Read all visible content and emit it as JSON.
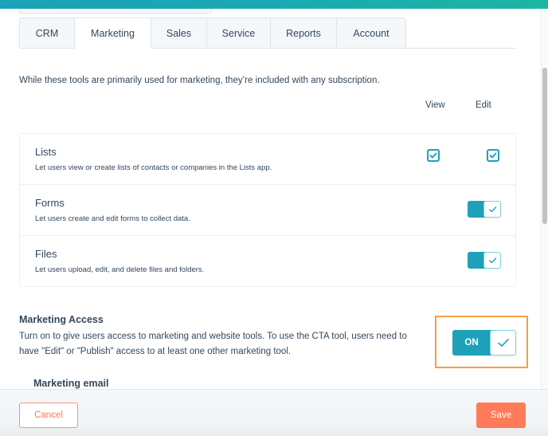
{
  "tabs": [
    {
      "label": "CRM",
      "active": false
    },
    {
      "label": "Marketing",
      "active": true
    },
    {
      "label": "Sales",
      "active": false
    },
    {
      "label": "Service",
      "active": false
    },
    {
      "label": "Reports",
      "active": false
    },
    {
      "label": "Account",
      "active": false
    }
  ],
  "intro_text": "While these tools are primarily used for marketing, they’re included with any subscription.",
  "columns": {
    "view": "View",
    "edit": "Edit"
  },
  "permissions": [
    {
      "title": "Lists",
      "description": "Let users view or create lists of contacts or companies in the Lists app.",
      "control": "checkboxes",
      "view": true,
      "edit": true
    },
    {
      "title": "Forms",
      "description": "Let users create and edit forms to collect data.",
      "control": "toggle",
      "enabled": true
    },
    {
      "title": "Files",
      "description": "Let users upload, edit, and delete files and folders.",
      "control": "toggle",
      "enabled": true
    }
  ],
  "marketing_access": {
    "title": "Marketing Access",
    "description": "Turn on to give users access to marketing and website tools. To use the CTA tool, users need to have \"Edit\" or \"Publish\" access to at least one other marketing tool.",
    "toggle_label": "ON",
    "enabled": true
  },
  "clipped_heading": "Marketing email",
  "footer": {
    "cancel_label": "Cancel",
    "save_label": "Save"
  },
  "colors": {
    "accent": "#1ea1b8",
    "primary_button": "#ff7a59",
    "highlight": "#f5a142",
    "text": "#33475b"
  }
}
